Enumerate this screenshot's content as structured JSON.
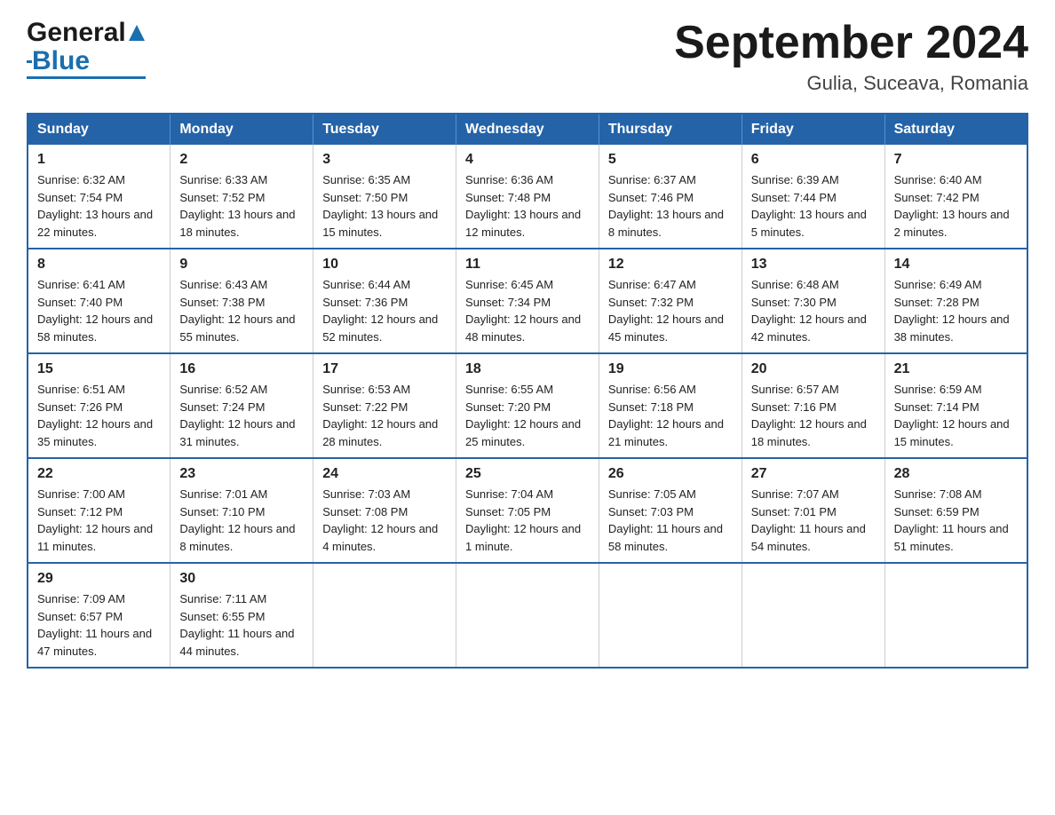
{
  "header": {
    "logo_general": "General",
    "logo_blue": "Blue",
    "month_year": "September 2024",
    "location": "Gulia, Suceava, Romania"
  },
  "weekdays": [
    "Sunday",
    "Monday",
    "Tuesday",
    "Wednesday",
    "Thursday",
    "Friday",
    "Saturday"
  ],
  "weeks": [
    [
      {
        "day": "1",
        "sunrise": "6:32 AM",
        "sunset": "7:54 PM",
        "daylight": "13 hours and 22 minutes."
      },
      {
        "day": "2",
        "sunrise": "6:33 AM",
        "sunset": "7:52 PM",
        "daylight": "13 hours and 18 minutes."
      },
      {
        "day": "3",
        "sunrise": "6:35 AM",
        "sunset": "7:50 PM",
        "daylight": "13 hours and 15 minutes."
      },
      {
        "day": "4",
        "sunrise": "6:36 AM",
        "sunset": "7:48 PM",
        "daylight": "13 hours and 12 minutes."
      },
      {
        "day": "5",
        "sunrise": "6:37 AM",
        "sunset": "7:46 PM",
        "daylight": "13 hours and 8 minutes."
      },
      {
        "day": "6",
        "sunrise": "6:39 AM",
        "sunset": "7:44 PM",
        "daylight": "13 hours and 5 minutes."
      },
      {
        "day": "7",
        "sunrise": "6:40 AM",
        "sunset": "7:42 PM",
        "daylight": "13 hours and 2 minutes."
      }
    ],
    [
      {
        "day": "8",
        "sunrise": "6:41 AM",
        "sunset": "7:40 PM",
        "daylight": "12 hours and 58 minutes."
      },
      {
        "day": "9",
        "sunrise": "6:43 AM",
        "sunset": "7:38 PM",
        "daylight": "12 hours and 55 minutes."
      },
      {
        "day": "10",
        "sunrise": "6:44 AM",
        "sunset": "7:36 PM",
        "daylight": "12 hours and 52 minutes."
      },
      {
        "day": "11",
        "sunrise": "6:45 AM",
        "sunset": "7:34 PM",
        "daylight": "12 hours and 48 minutes."
      },
      {
        "day": "12",
        "sunrise": "6:47 AM",
        "sunset": "7:32 PM",
        "daylight": "12 hours and 45 minutes."
      },
      {
        "day": "13",
        "sunrise": "6:48 AM",
        "sunset": "7:30 PM",
        "daylight": "12 hours and 42 minutes."
      },
      {
        "day": "14",
        "sunrise": "6:49 AM",
        "sunset": "7:28 PM",
        "daylight": "12 hours and 38 minutes."
      }
    ],
    [
      {
        "day": "15",
        "sunrise": "6:51 AM",
        "sunset": "7:26 PM",
        "daylight": "12 hours and 35 minutes."
      },
      {
        "day": "16",
        "sunrise": "6:52 AM",
        "sunset": "7:24 PM",
        "daylight": "12 hours and 31 minutes."
      },
      {
        "day": "17",
        "sunrise": "6:53 AM",
        "sunset": "7:22 PM",
        "daylight": "12 hours and 28 minutes."
      },
      {
        "day": "18",
        "sunrise": "6:55 AM",
        "sunset": "7:20 PM",
        "daylight": "12 hours and 25 minutes."
      },
      {
        "day": "19",
        "sunrise": "6:56 AM",
        "sunset": "7:18 PM",
        "daylight": "12 hours and 21 minutes."
      },
      {
        "day": "20",
        "sunrise": "6:57 AM",
        "sunset": "7:16 PM",
        "daylight": "12 hours and 18 minutes."
      },
      {
        "day": "21",
        "sunrise": "6:59 AM",
        "sunset": "7:14 PM",
        "daylight": "12 hours and 15 minutes."
      }
    ],
    [
      {
        "day": "22",
        "sunrise": "7:00 AM",
        "sunset": "7:12 PM",
        "daylight": "12 hours and 11 minutes."
      },
      {
        "day": "23",
        "sunrise": "7:01 AM",
        "sunset": "7:10 PM",
        "daylight": "12 hours and 8 minutes."
      },
      {
        "day": "24",
        "sunrise": "7:03 AM",
        "sunset": "7:08 PM",
        "daylight": "12 hours and 4 minutes."
      },
      {
        "day": "25",
        "sunrise": "7:04 AM",
        "sunset": "7:05 PM",
        "daylight": "12 hours and 1 minute."
      },
      {
        "day": "26",
        "sunrise": "7:05 AM",
        "sunset": "7:03 PM",
        "daylight": "11 hours and 58 minutes."
      },
      {
        "day": "27",
        "sunrise": "7:07 AM",
        "sunset": "7:01 PM",
        "daylight": "11 hours and 54 minutes."
      },
      {
        "day": "28",
        "sunrise": "7:08 AM",
        "sunset": "6:59 PM",
        "daylight": "11 hours and 51 minutes."
      }
    ],
    [
      {
        "day": "29",
        "sunrise": "7:09 AM",
        "sunset": "6:57 PM",
        "daylight": "11 hours and 47 minutes."
      },
      {
        "day": "30",
        "sunrise": "7:11 AM",
        "sunset": "6:55 PM",
        "daylight": "11 hours and 44 minutes."
      },
      null,
      null,
      null,
      null,
      null
    ]
  ]
}
